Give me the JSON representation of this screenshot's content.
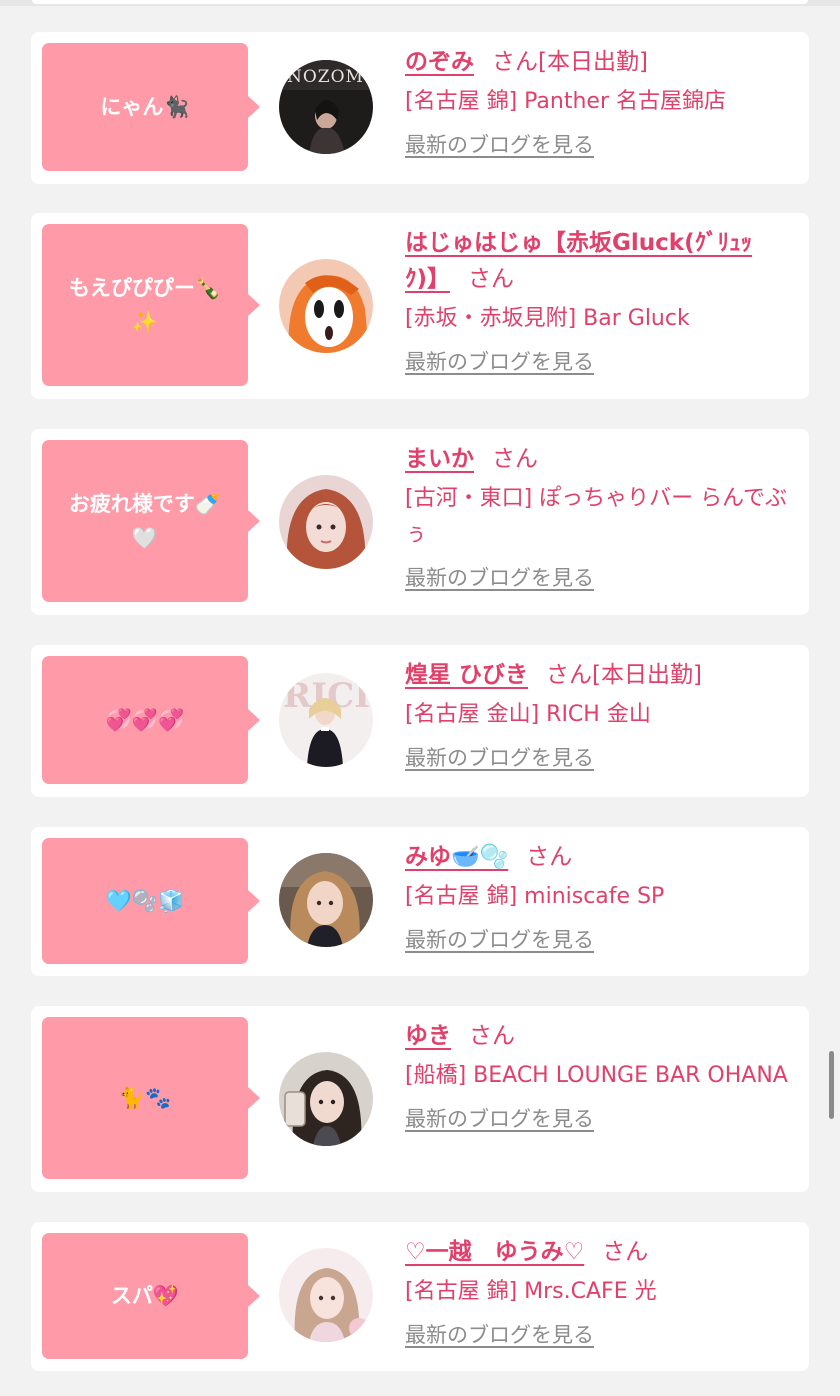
{
  "suffix_label": "さん",
  "blog_link_label": "最新のブログを見る",
  "cards": [
    {
      "comment": "にゃん🐈‍⬛",
      "name": "のぞみ",
      "status": "[本日出勤]",
      "shop": "[名古屋 錦] Panther 名古屋錦店",
      "avatar_icon": "photo-dark-portrait"
    },
    {
      "comment": "もえぴぴぴー🍾✨",
      "name": "はじゅはじゅ【赤坂Gluck(ｸﾞﾘｭｯｸ)】",
      "status": "",
      "shop": "[赤坂・赤坂見附] Bar Gluck",
      "avatar_icon": "illustration-orange-hair"
    },
    {
      "comment": "お疲れ様です🍼🤍",
      "name": "まいか",
      "status": "",
      "shop": "[古河・東口] ぽっちゃりバー らんでぶぅ",
      "avatar_icon": "photo-portrait"
    },
    {
      "comment": "💞💞💞",
      "name": "煌星 ひびき",
      "status": "[本日出勤]",
      "shop": "[名古屋 金山] RICH 金山",
      "avatar_icon": "photo-magazine-cover"
    },
    {
      "comment": "🩵🫧🧊",
      "name": "みゆ🥣🫧",
      "status": "",
      "shop": "[名古屋 錦] miniscafe SP",
      "avatar_icon": "photo-portrait"
    },
    {
      "comment": "🐈🐾",
      "name": "ゆき",
      "status": "",
      "shop": "[船橋] BEACH LOUNGE BAR OHANA",
      "avatar_icon": "photo-selfie"
    },
    {
      "comment": "スパ💖",
      "name": "♡一越　ゆうみ♡",
      "status": "",
      "shop": "[名古屋 錦] Mrs.CAFE 光",
      "avatar_icon": "photo-portrait-light"
    }
  ]
}
